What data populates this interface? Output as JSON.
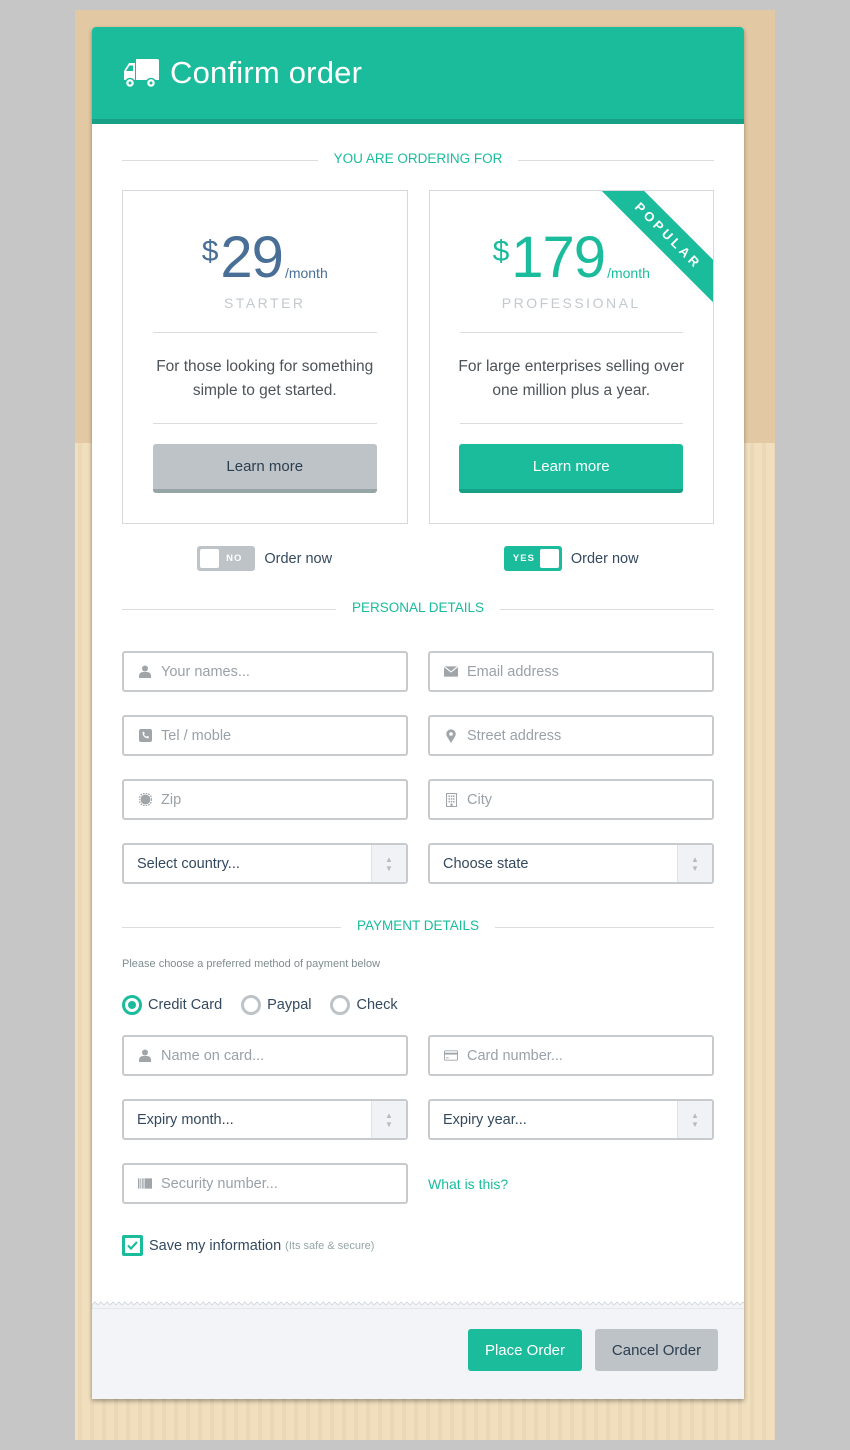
{
  "header": {
    "title": "Confirm order",
    "icon": "truck-icon"
  },
  "colors": {
    "accent": "#1abc9c",
    "accent_dark": "#16a085",
    "muted": "#bdc3c7",
    "price_starter": "#4a6f96"
  },
  "sections": {
    "ordering": "YOU ARE ORDERING FOR",
    "personal": "PERSONAL DETAILS",
    "payment": "PAYMENT DETAILS"
  },
  "plans": [
    {
      "currency": "$",
      "amount": "29",
      "period": "/month",
      "name": "STARTER",
      "description": "For those looking for something simple to get started.",
      "button": "Learn more",
      "toggle_label": "NO",
      "toggle_on": false,
      "toggle_text": "Order now"
    },
    {
      "currency": "$",
      "amount": "179",
      "period": "/month",
      "name": "PROFESSIONAL",
      "description": "For large enterprises selling over one million plus a year.",
      "button": "Learn more",
      "ribbon": "POPULAR",
      "toggle_label": "YES",
      "toggle_on": true,
      "toggle_text": "Order now"
    }
  ],
  "personal": {
    "name": {
      "placeholder": "Your names...",
      "icon": "user-icon"
    },
    "email": {
      "placeholder": "Email address",
      "icon": "envelope-icon"
    },
    "phone": {
      "placeholder": "Tel / moble",
      "icon": "phone-icon"
    },
    "street": {
      "placeholder": "Street address",
      "icon": "map-marker-icon"
    },
    "zip": {
      "placeholder": "Zip",
      "icon": "certificate-icon"
    },
    "city": {
      "placeholder": "City",
      "icon": "building-icon"
    },
    "country": {
      "selected": "Select country..."
    },
    "state": {
      "selected": "Choose state"
    }
  },
  "payment": {
    "hint": "Please choose a preferred method of payment below",
    "methods": [
      {
        "label": "Credit Card",
        "checked": true
      },
      {
        "label": "Paypal",
        "checked": false
      },
      {
        "label": "Check",
        "checked": false
      }
    ],
    "card_name": {
      "placeholder": "Name on card...",
      "icon": "user-icon"
    },
    "card_number": {
      "placeholder": "Card number...",
      "icon": "credit-card-icon"
    },
    "expiry_month": {
      "selected": "Expiry month..."
    },
    "expiry_year": {
      "selected": "Expiry year..."
    },
    "security": {
      "placeholder": "Security number...",
      "icon": "barcode-icon"
    },
    "what_is_this": "What is this?",
    "save": {
      "label": "Save my information",
      "note": "(Its safe & secure)",
      "checked": true
    }
  },
  "footer": {
    "place_order": "Place Order",
    "cancel_order": "Cancel Order"
  }
}
